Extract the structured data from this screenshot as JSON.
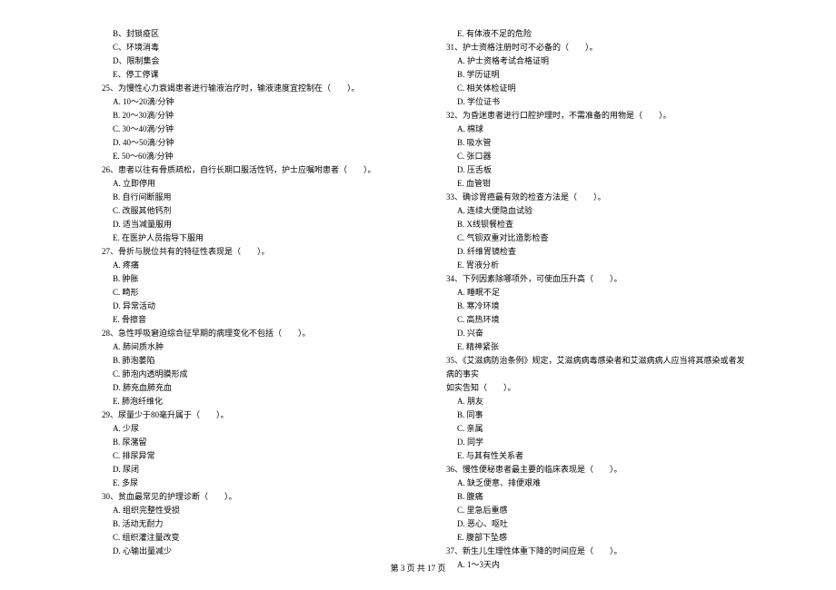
{
  "left": {
    "l0": "B、封锁疫区",
    "l1": "C、环境消毒",
    "l2": "D、限制集会",
    "l3": "E、停工停课",
    "q25": "25、为慢性心力衰竭患者进行输液治疗时，输液速度宜控制在（　　）。",
    "l4": "A. 10～20滴/分钟",
    "l5": "B. 20～30滴/分钟",
    "l6": "C. 30～40滴/分钟",
    "l7": "D. 40～50滴/分钟",
    "l8": "E. 50～60滴/分钟",
    "q26": "26、患者以往有骨质疏松，自行长期口服活性钙，护士应嘱咐患者（　　）。",
    "l9": "A. 立即停用",
    "l10": "B. 自行间断服用",
    "l11": "C. 改服其他钙剂",
    "l12": "D. 适当减量服用",
    "l13": "E. 在医护人员指导下服用",
    "q27": "27、骨折与脱位共有的特征性表现是（　　）。",
    "l14": "A.  疼痛",
    "l15": "B.  肿胀",
    "l16": "C.  畸形",
    "l17": "D.  异常活动",
    "l18": "E.  骨擦音",
    "q28": "28、急性呼吸窘迫综合征早期的病理变化不包括（　　）。",
    "l19": "A. 肺间质水肿",
    "l20": "B. 肺泡萎陷",
    "l21": "C. 肺泡内透明膜形成",
    "l22": "D. 肺充血肺充血",
    "l23": "E. 肺泡纤维化",
    "q29": "29、尿量少于80毫升属于（　　）。",
    "l24": "A. 少尿",
    "l25": "B. 尿潴留",
    "l26": "C. 排尿异常",
    "l27": "D. 尿闭",
    "l28": "E.  多尿",
    "q30": "30、贫血最常见的护理诊断（　　）。",
    "l29": "A. 组织完整性受损",
    "l30": "B. 活动无耐力",
    "l31": "C. 组织灌注量改变",
    "l32": "D. 心输出量减少"
  },
  "right": {
    "r0": "E. 有体液不足的危险",
    "q31": "31、护士资格注册时可不必备的（　　）。",
    "r1": "A. 护士资格考试合格证明",
    "r2": "B. 学历证明",
    "r3": "C. 相关体检证明",
    "r4": "D. 学位证书",
    "q32": "32、为昏迷患者进行口腔护理时，不需准备的用物是（　　）。",
    "r5": "A. 棉球",
    "r6": "B. 吸水管",
    "r7": "C. 张口器",
    "r8": "D. 压舌板",
    "r9": "E. 血管钳",
    "q33": "33、确诊胃癌最有效的检查方法是（　　）。",
    "r10": "A. 连续大便隐血试验",
    "r11": "B. X线钡餐检查",
    "r12": "C. 气钡双重对比造影检查",
    "r13": "D. 纤维胃镜检查",
    "r14": "E. 胃液分析",
    "q34": "34、下列因素除哪项外，可使血压升高（　　）。",
    "r15": "A. 睡眠不足",
    "r16": "B. 寒冷环境",
    "r17": "C. 高热环境",
    "r18": "D. 兴奋",
    "r19": "E. 精神紧张",
    "q35": "35、《艾滋病防治条例》规定，艾滋病病毒感染者和艾滋病病人应当将其感染或者发病的事实",
    "q35b": "如实告知（　　）。",
    "r20": "A.  朋友",
    "r21": "B.  同事",
    "r22": "C.  亲属",
    "r23": "D.  同学",
    "r24": "E.  与其有性关系者",
    "q36": "36、慢性便秘患者最主要的临床表现是（　　）。",
    "r25": "A. 缺乏便意、排便艰难",
    "r26": "B. 腹痛",
    "r27": "C. 里急后重感",
    "r28": "D. 恶心、呕吐",
    "r29": "E. 腹部下坠感",
    "q37": "37、新生儿生理性体重下降的时间应是（　　）。",
    "r30": "A. 1～3天内"
  },
  "footer": "第 3 页 共 17 页"
}
